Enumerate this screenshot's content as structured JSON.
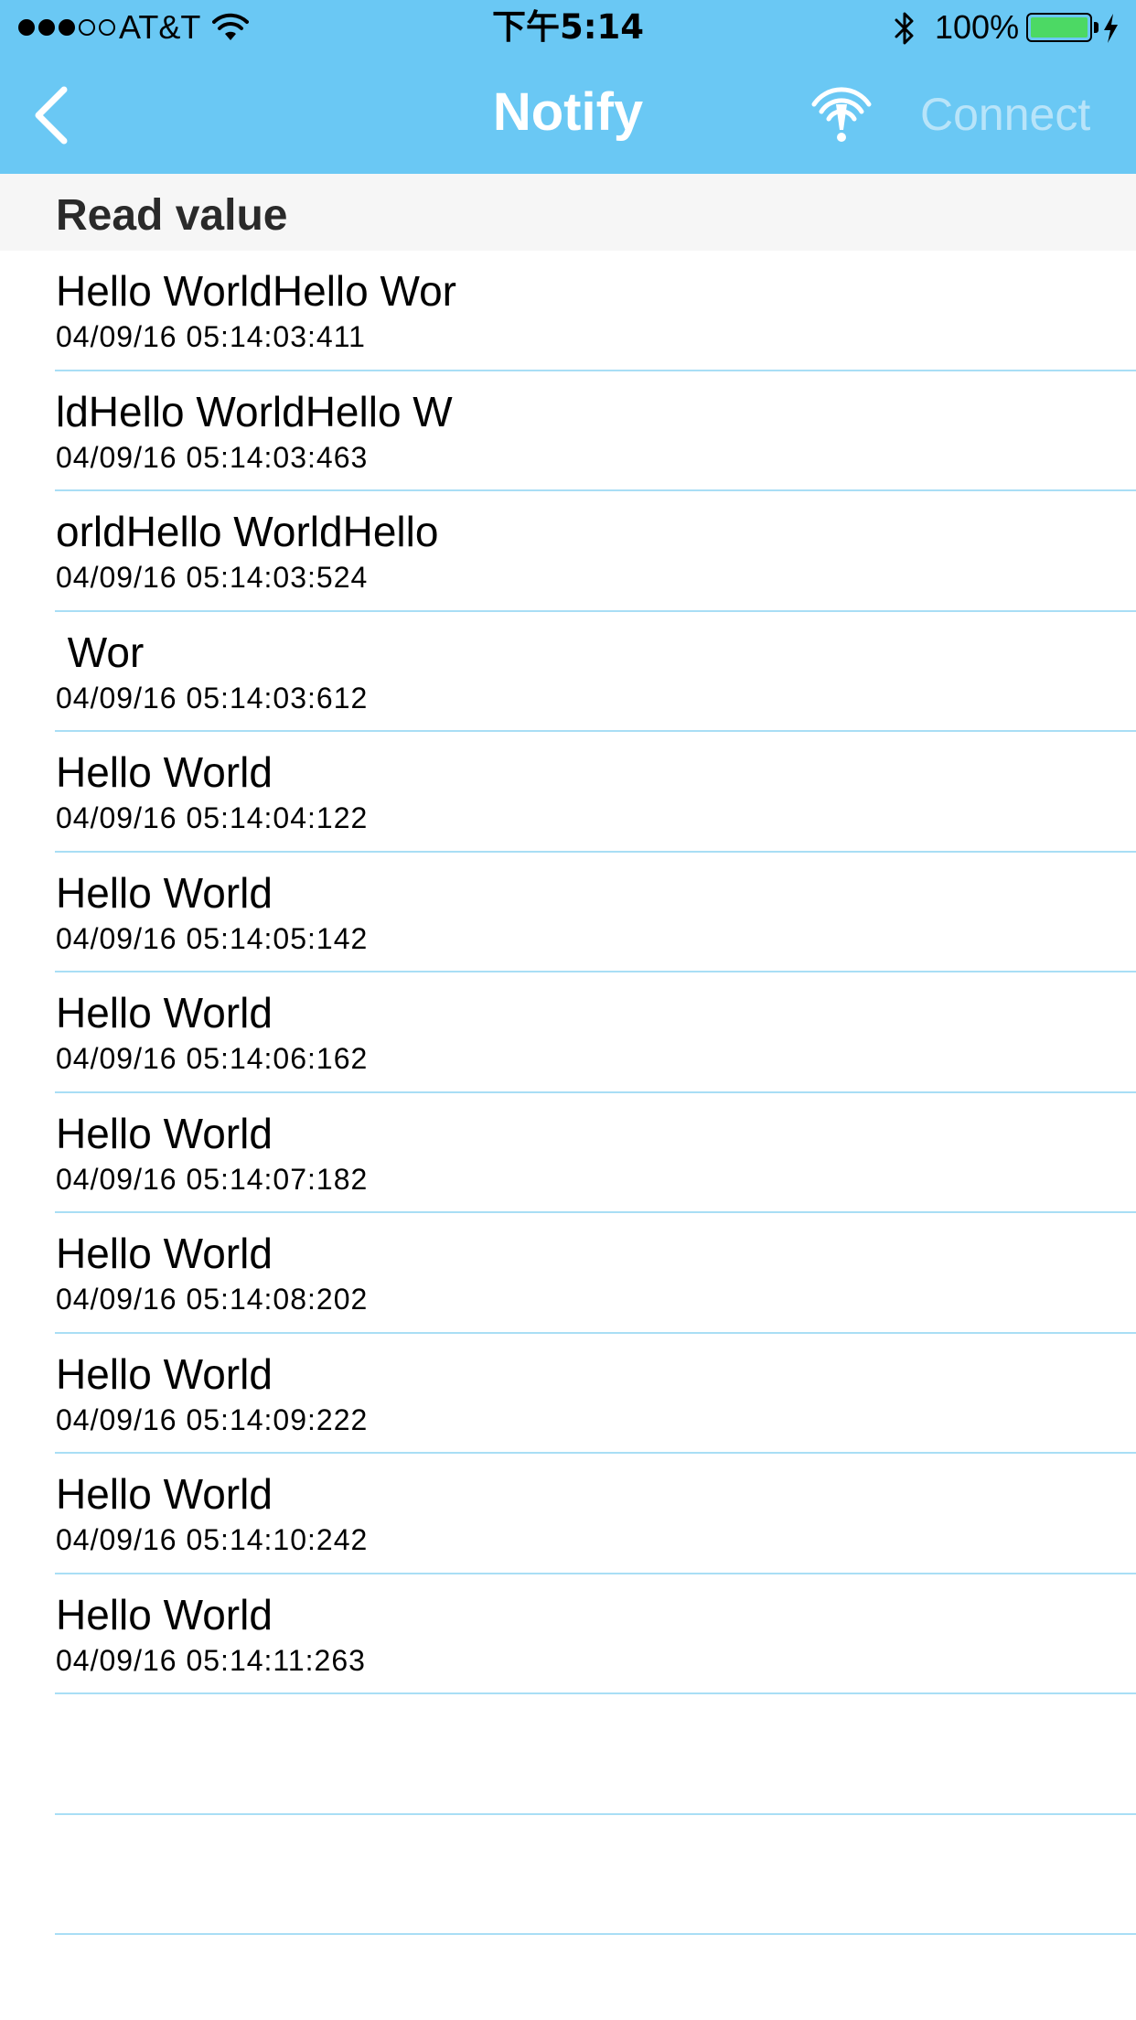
{
  "status_bar": {
    "carrier": "AT&T",
    "time": "下午5:14",
    "battery_percent": "100%",
    "signal_bars_filled": 3,
    "signal_bars_total": 5,
    "icons": [
      "signal-dots-icon",
      "wifi-icon",
      "bluetooth-icon",
      "battery-icon",
      "charging-bolt-icon"
    ]
  },
  "nav": {
    "back_icon": "chevron-left-icon",
    "title": "Notify",
    "antenna_icon": "antenna-signal-icon",
    "connect_label": "Connect"
  },
  "section": {
    "title": "Read value"
  },
  "rows": [
    {
      "value": "Hello WorldHello Wor",
      "timestamp": "04/09/16 05:14:03:411"
    },
    {
      "value": "ldHello WorldHello W",
      "timestamp": "04/09/16 05:14:03:463"
    },
    {
      "value": "orldHello WorldHello",
      "timestamp": "04/09/16 05:14:03:524"
    },
    {
      "value": " Wor",
      "timestamp": "04/09/16 05:14:03:612"
    },
    {
      "value": "Hello World",
      "timestamp": "04/09/16 05:14:04:122"
    },
    {
      "value": "Hello World",
      "timestamp": "04/09/16 05:14:05:142"
    },
    {
      "value": "Hello World",
      "timestamp": "04/09/16 05:14:06:162"
    },
    {
      "value": "Hello World",
      "timestamp": "04/09/16 05:14:07:182"
    },
    {
      "value": "Hello World",
      "timestamp": "04/09/16 05:14:08:202"
    },
    {
      "value": "Hello World",
      "timestamp": "04/09/16 05:14:09:222"
    },
    {
      "value": "Hello World",
      "timestamp": "04/09/16 05:14:10:242"
    },
    {
      "value": "Hello World",
      "timestamp": "04/09/16 05:14:11:263"
    },
    {
      "value": "",
      "timestamp": ""
    },
    {
      "value": "",
      "timestamp": ""
    }
  ],
  "colors": {
    "nav_background": "#6ac8f4",
    "separator": "#a9def5",
    "connect_disabled": "#b8e4f9",
    "battery_fill": "#4cd964"
  }
}
